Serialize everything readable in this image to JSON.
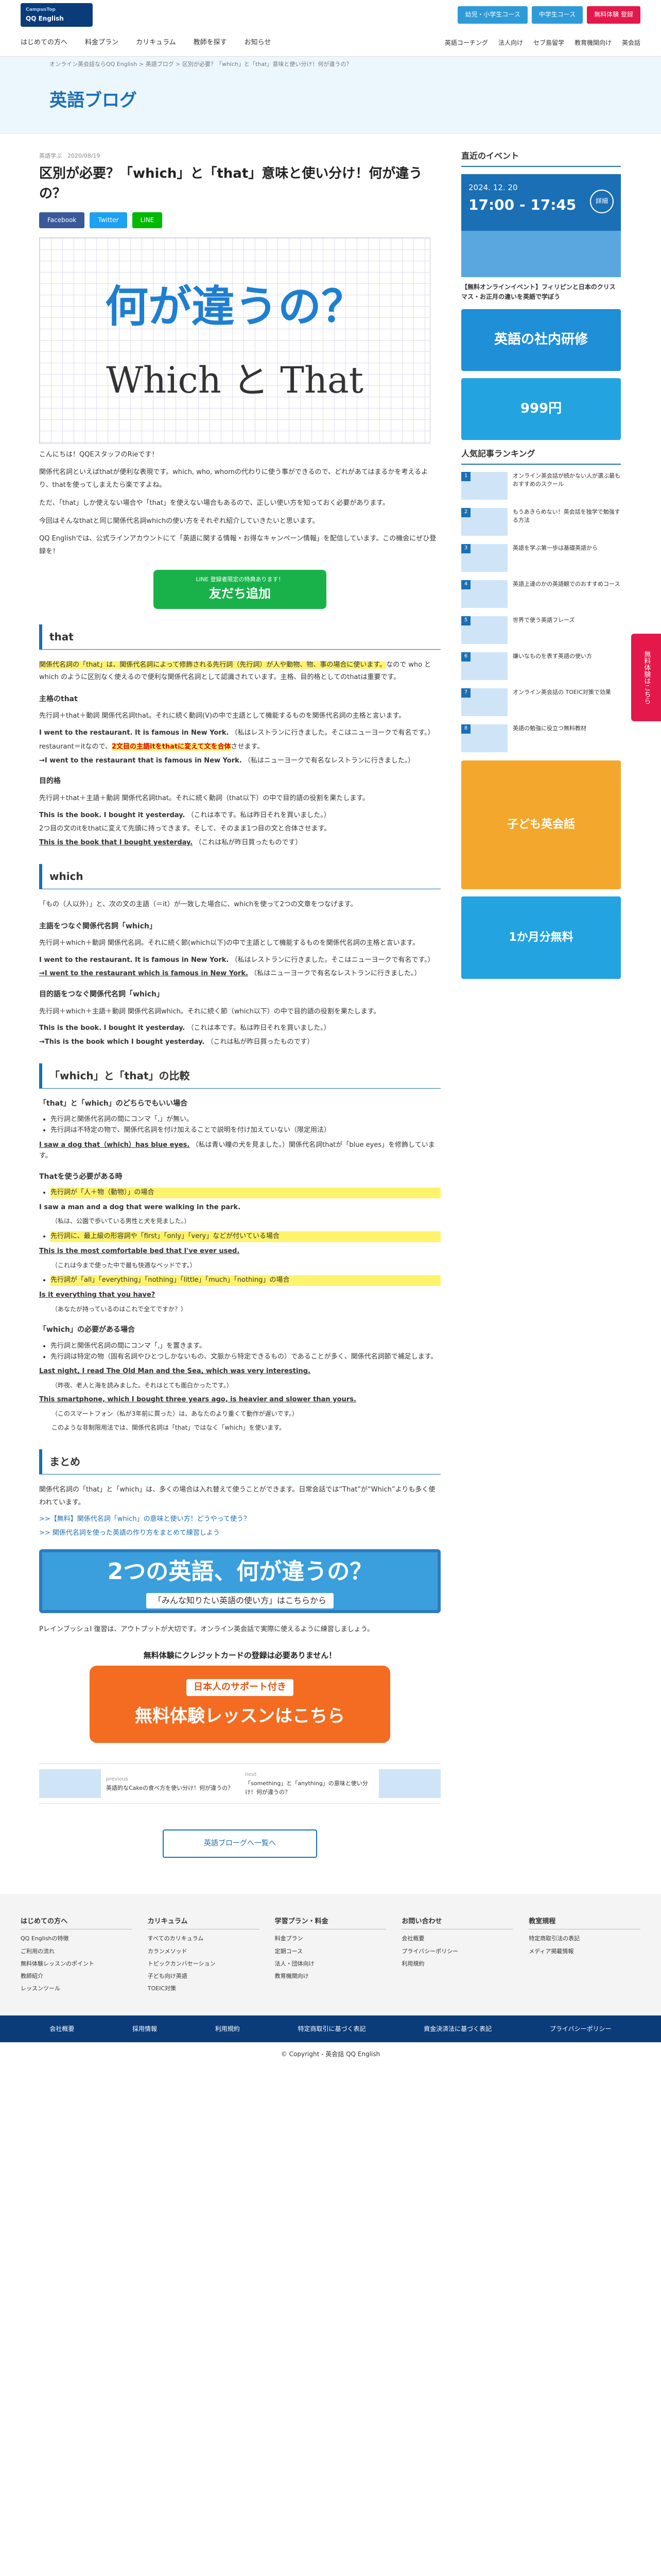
{
  "brand": {
    "logo_top": "CampusTop",
    "logo_name": "QQ English"
  },
  "top_buttons": [
    {
      "label": "幼児・小学生コース",
      "color": "#2e9bd8"
    },
    {
      "label": "中学生コース",
      "color": "#2e9bd8"
    },
    {
      "label": "無料体験 登録",
      "color": "#e5184b"
    }
  ],
  "nav": {
    "items": [
      "はじめての方へ",
      "料金プラン",
      "カリキュラム",
      "教師を探す",
      "お知らせ"
    ],
    "right": [
      "英語コーチング",
      "法人向け",
      "セブ島留学",
      "教育機関向け",
      "英会話"
    ]
  },
  "breadcrumb": "オンライン英会話ならQQ English > 英語ブログ > 区別が必要？「which」と「that」意味と使い分け！何が違うの？",
  "page_title": "英語ブログ",
  "article": {
    "meta": "英語学ぶ　2020/08/19",
    "title": "区別が必要？「which」と「that」意味と使い分け！何が違うの？",
    "share": [
      {
        "label": "Facebook",
        "color": "#3b5998"
      },
      {
        "label": "Twitter",
        "color": "#1da1f2"
      },
      {
        "label": "LINE",
        "color": "#00b900"
      }
    ],
    "hero_top": "何が違うの？",
    "hero_bottom": "Which と That",
    "intro1": "こんにちは！QQEスタッフのRieです！",
    "intro2": "関係代名詞といえばthatが便利な表現です。which, who, whomの代わりに使う事ができるので、どれがあてはまるかを考えるより、thatを使ってしまえたら楽ですよね。",
    "intro3": "ただ、「that」しか使えない場合や「that」を使えない場合もあるので、正しい使い方を知っておく必要があります。",
    "intro4": "今回はそんなthatと同じ関係代名詞whichの使い方をそれぞれ紹介していきたいと思います。",
    "intro5": "QQ Englishでは、公式ラインアカウントにて「英語に関する情報・お得なキャンペーン情報」を配信しています。この機会にぜひ登録を！",
    "line_small": "LINE 登録者限定の特典あります！",
    "line_big": "友だち追加",
    "h_that": "that",
    "that_p1": "関係代名詞の「that」は、関係代名詞によって修飾される先行詞（先行詞）が人や動物、物、事の場合に使います。",
    "that_p1b": "なので who と which のように区別なく使えるので便利な関係代名詞として認識されています。主格、目的格としてのthatは重要です。",
    "h_subj": "主格のthat",
    "subj_p": "先行詞＋that＋動詞 関係代名詞that。それに続く動詞(V)の中で主語として機能するものを関係代名詞の主格と言います。",
    "ex1": "I went to the restaurant. It is famous in New York.",
    "ex1_ja": "（私はレストランに行きました。そこはニューヨークで有名です。）",
    "ex2a": "restaurant＝itなので、",
    "ex2b": "2文目の主語itをthatに変えて文を合体",
    "ex2c": "させます。",
    "ex3": "→I went to the restaurant that is famous in New York.",
    "ex3_ja": "（私はニューヨークで有名なレストランに行きました。）",
    "h_obj": "目的格",
    "obj_p": "先行詞＋that＋主語＋動詞 関係代名詞that。それに続く動詞（that以下）の中で目的語の役割を果たします。",
    "ex4": "This is the book. I bought it yesterday.",
    "ex4_ja": "（これは本です。私は昨日それを買いました。）",
    "ex5": "2つ目の文のitをthatに変えて先頭に持ってきます。そして、そのまま1つ目の文と合体させます。",
    "ex6": "This is the book that I bought yesterday.",
    "ex6_ja": "（これは私が昨日買ったものです）",
    "h_which": "which",
    "which_p": "「もの（人以外）」と、次の文の主語（＝it）が一致した場合に、whichを使って2つの文章をつなげます。",
    "h_w_subj": "主語をつなぐ関係代名詞「which」",
    "w_subj_p": "先行詞＋which＋動詞 関係代名詞。それに続く節(which以下)の中で主語として機能するものを関係代名詞の主格と言います。",
    "ex7": "I went to the restaurant. It is famous in New York.",
    "ex7_ja": "（私はレストランに行きました。そこはニューヨークで有名です。）",
    "ex8": "→I went to the restaurant which is famous in New York.",
    "ex8_ja": "（私はニューヨークで有名なレストランに行きました。）",
    "h_w_obj": "目的語をつなぐ関係代名詞「which」",
    "w_obj_p": "先行詞＋which＋主語＋動詞 関係代名詞which。それに続く節（which以下）の中で目的語の役割を果たします。",
    "ex9": "This is the book. I bought it yesterday.",
    "ex9_ja": "（これは本です。私は昨日それを買いました。）",
    "ex10": "→This is the book which I bought yesterday.",
    "ex10_ja": "（これは私が昨日買ったものです）",
    "h_compare": "「which」と「that」の比較",
    "h_both": "「that」と「which」のどちらでもいい場合",
    "both_pts": [
      "先行詞と関係代名詞の間にコンマ「,」が無い。",
      "先行詞は不特定の物で、関係代名詞を付け加えることで説明を付け加えていない（限定用法）"
    ],
    "ex11": "I saw a dog that（which）has blue eyes.",
    "ex11_ja": "（私は青い瞳の犬を見ました。）関係代名詞thatが「blue eyes」を修飾しています。",
    "h_that_only": "Thatを使う必要がある時",
    "that_only_pts": [
      "先行詞が「人＋物（動物）」の場合"
    ],
    "ex12": "I saw a man and a dog that were walking in the park.",
    "ex12_ja": "（私は、公園で歩いている男性と犬を見ました。）",
    "that_only_pts2": [
      "先行詞に、最上級の形容詞や「first」「only」「very」などが付いている場合"
    ],
    "ex13": "This is the most comfortable bed that I've ever used.",
    "ex13_ja": "（これは今まで使った中で最も快適なベッドです。）",
    "that_only_pts3": [
      "先行詞が「all」「everything」「nothing」「little」「much」「nothing」の場合"
    ],
    "ex14": "Is it everything that you have?",
    "ex14_ja": "（あなたが持っているのはこれで全てですか？）",
    "h_which_only": "「which」の必要がある場合",
    "which_only_pts": [
      "先行詞と関係代名詞の間にコンマ「,」を置きます。",
      "先行詞は特定の物（固有名詞やひとつしかないもの、文脈から特定できるもの）であることが多く、関係代名詞節で補足します。"
    ],
    "ex15": "Last night, I read The Old Man and the Sea, which was very interesting.",
    "ex15_ja": "（昨夜、老人と海を読みました。それはとても面白かったです。）",
    "ex16": "This smartphone, which I bought three years ago, is heavier and slower than yours.",
    "ex16_ja": "（このスマートフォン（私が3年前に買った）は、あなたのより重くて動作が遅いです。）",
    "compare_end": "このような非制限用法では、関係代名詞は「that」ではなく「which」を使います。",
    "h_summary": "まとめ",
    "summary_p": "関係代名詞の「that」と「which」は、多くの場合は入れ替えて使うことができます。日常会話では“That”が“Which”よりも多く使われています。",
    "summary_links": [
      ">>【無料】関係代名詞「which」の意味と使い方！どうやって使う？",
      ">> 関係代名詞を使った英語の作り方をまとめて練習しよう"
    ],
    "summary_box_t1": "2つの英語、何が違うの？",
    "summary_box_t2": "「みんな知りたい英語の使い方」はこちらから",
    "closing": "PレインブッシュI 復習は、アウトプットが大切です。オンライン英会話で実際に使えるように練習しましょう。",
    "cta_lead": "無料体験にクレジットカードの登録は必要ありません！",
    "cta_a": "日本人のサポート付き",
    "cta_b": "無料体験レッスンはこちら",
    "prev_label": "previous",
    "prev_title": "英語的なCakeの食べ方を使い分け！何が違うの？",
    "next_label": "next",
    "next_title": "「something」と「anything」の意味と使い分け！何が違うの？",
    "back": "英語ブローグへ一覧へ"
  },
  "side": {
    "events_h": "直近のイベント",
    "event_date": "2024. 12. 20",
    "event_time": "17:00 - 17:45",
    "event_btn": "詳細",
    "event_text": "【無料オンラインイベント】フィリピンと日本のクリスマス・お正月の違いを英語で学ぼう",
    "ad1": "英語の社内研修",
    "ad2": "999円",
    "rank_h": "人気記事ランキング",
    "rank": [
      "オンライン英会話が続かない人が選ぶ最もおすすめのスクール",
      "もうあきらめない！英会話を独学で勉強する方法",
      "英語を学ぶ第一歩は基礎英語から",
      "英語上達のかの英語観でのおすすめコース",
      "世界で使う英語フレーズ",
      "嫌いなものを表す英語の使い方",
      "オンライン英会話の TOEIC対策で効果",
      "英語の勉強に役立つ無料教材"
    ],
    "ad3": "子ども英会話",
    "ad4": "1か月分無料"
  },
  "float": "無料体験はこちら",
  "footer": {
    "cols": [
      {
        "h": "はじめての方へ",
        "items": [
          "QQ Englishの特徴",
          "ご利用の流れ",
          "無料体験レッスンのポイント",
          "教師紹介",
          "レッスンツール"
        ]
      },
      {
        "h": "カリキュラム",
        "items": [
          "すべてのカリキュラム",
          "カランメソッド",
          "トピックカンバセーション",
          "子ども向け英語",
          "TOEIC対策"
        ]
      },
      {
        "h": "学習プラン・料金",
        "items": [
          "料金プラン",
          "定期コース",
          "法人・団体向け",
          "教育機関向け"
        ]
      },
      {
        "h": "お問い合わせ",
        "items": [
          "会社概要",
          "プライバシーポリシー",
          "利用規約"
        ]
      },
      {
        "h": "教室規程",
        "items": [
          "特定商取引法の表記",
          "メディア掲載情報"
        ]
      }
    ],
    "bar": [
      "会社概要",
      "採用情報",
      "利用規約",
      "特定商取引に基づく表記",
      "資金決済法に基づく表記",
      "プライバシーポリシー"
    ],
    "copy": "© Copyright - 英会話 QQ English"
  }
}
